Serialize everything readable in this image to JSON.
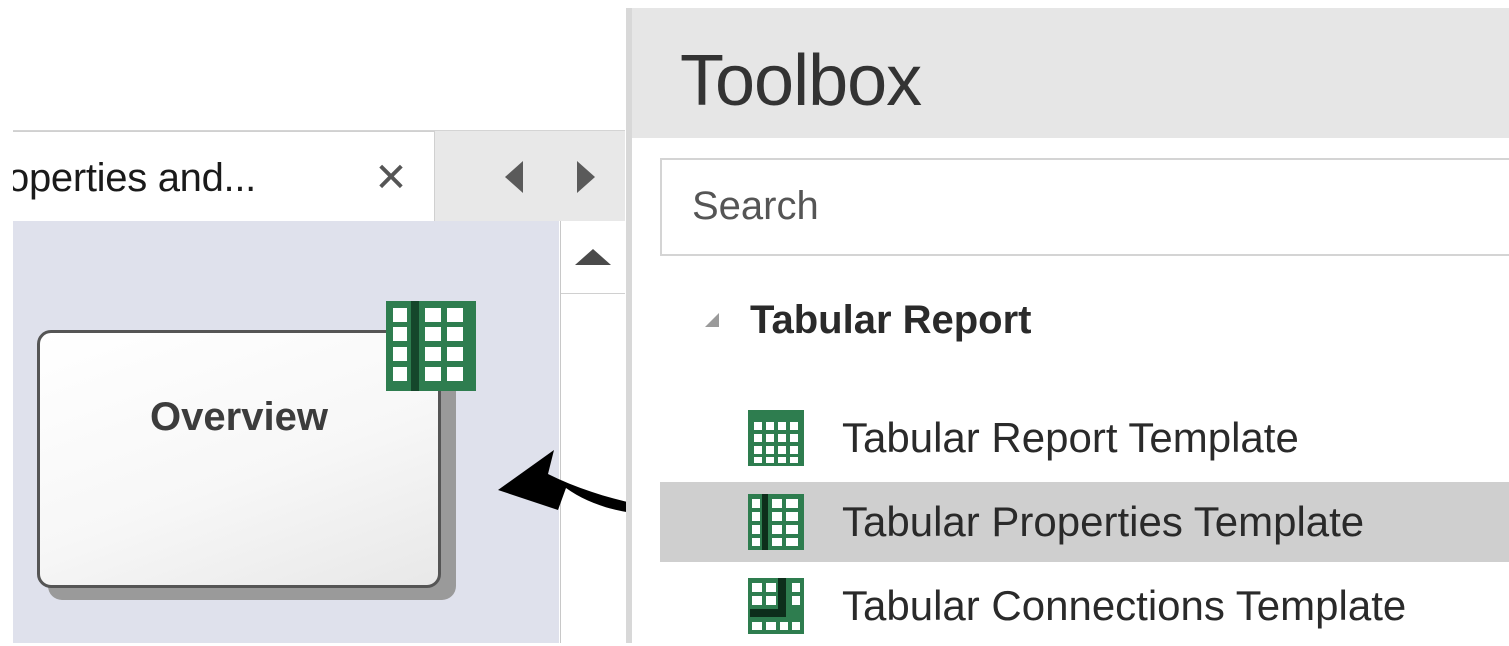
{
  "diagram_tabs": {
    "active_tab_label": "operties and...",
    "close_glyph": "✕"
  },
  "diagram": {
    "element_title": "Overview",
    "element_badge_icon": "tabular-properties-icon"
  },
  "toolbox": {
    "title": "Toolbox",
    "search_placeholder": "Search",
    "group": {
      "label": "Tabular Report",
      "caret_icon": "expanded-caret-icon"
    },
    "items": [
      {
        "label": "Tabular Report Template",
        "icon": "tabular-report-icon",
        "selected": false
      },
      {
        "label": "Tabular Properties Template",
        "icon": "tabular-properties-icon",
        "selected": true
      },
      {
        "label": "Tabular Connections Template",
        "icon": "tabular-connections-icon",
        "selected": false
      }
    ]
  },
  "colors": {
    "icon_green": "#2e7d4f",
    "canvas_bg": "#dfe1ec",
    "selected_bg": "#cfcfcf"
  }
}
